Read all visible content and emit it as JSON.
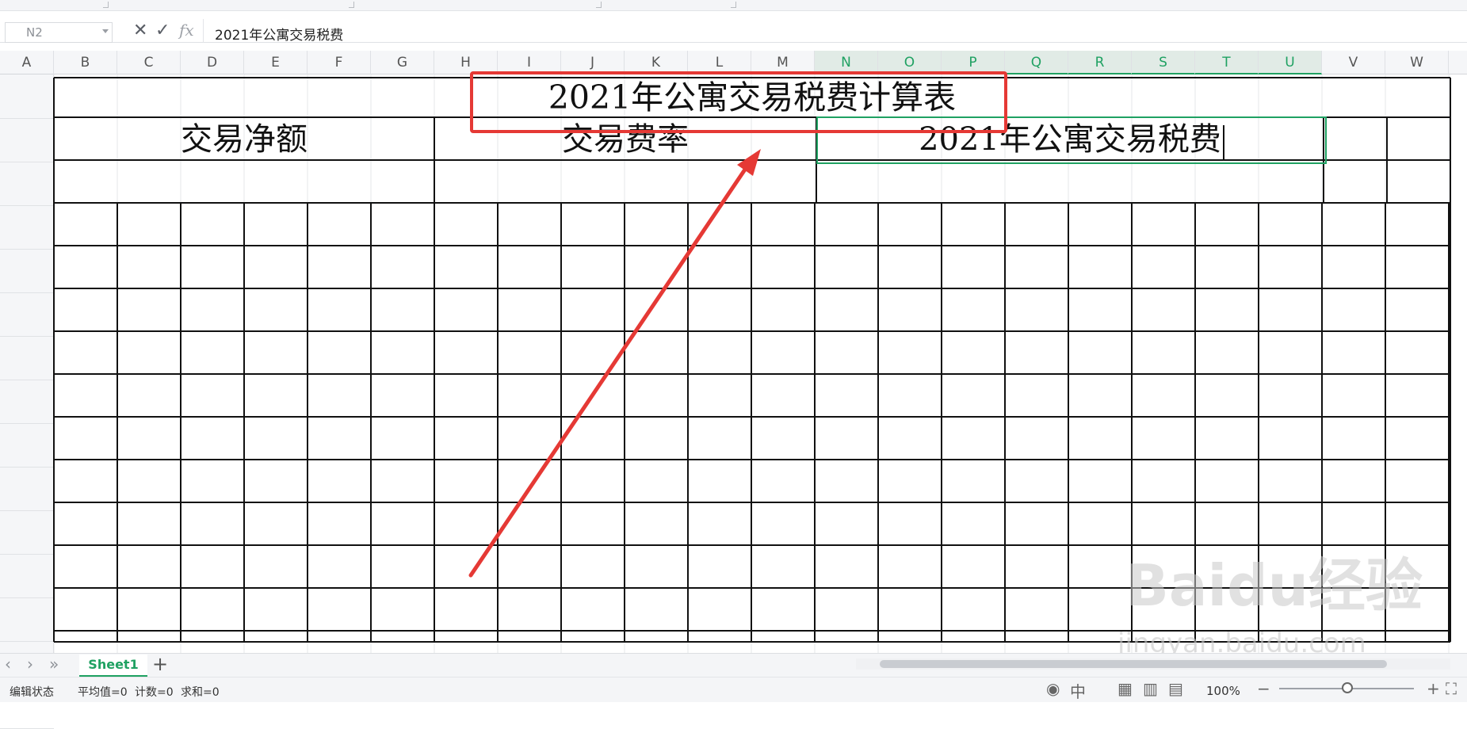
{
  "formula_bar": {
    "name_box": "N2",
    "fx": "fx",
    "cancel_icon": "close-icon",
    "confirm_icon": "check-icon",
    "content": "2021年公寓交易税费"
  },
  "columns": [
    "A",
    "B",
    "C",
    "D",
    "E",
    "F",
    "G",
    "H",
    "I",
    "J",
    "K",
    "L",
    "M",
    "N",
    "O",
    "P",
    "Q",
    "R",
    "S",
    "T",
    "U",
    "V",
    "W"
  ],
  "selected_columns": [
    "N",
    "O",
    "P",
    "Q",
    "R",
    "S",
    "T",
    "U"
  ],
  "sheet": {
    "title": "2021年公寓交易税费计算表",
    "headers": [
      "交易净额",
      "交易费率",
      "2021年公寓交易税费"
    ]
  },
  "sheet_tabs": {
    "active": "Sheet1",
    "add_icon": "plus-icon"
  },
  "status": {
    "mode": "编辑状态",
    "average": "平均值=0",
    "count": "计数=0",
    "sum": "求和=0",
    "zoom": "100%"
  },
  "colors": {
    "accent_green": "#1fa162",
    "annotation_red": "#e53935"
  },
  "watermark": {
    "brand": "Baidu经验",
    "url": "jingyan.baidu.com"
  }
}
